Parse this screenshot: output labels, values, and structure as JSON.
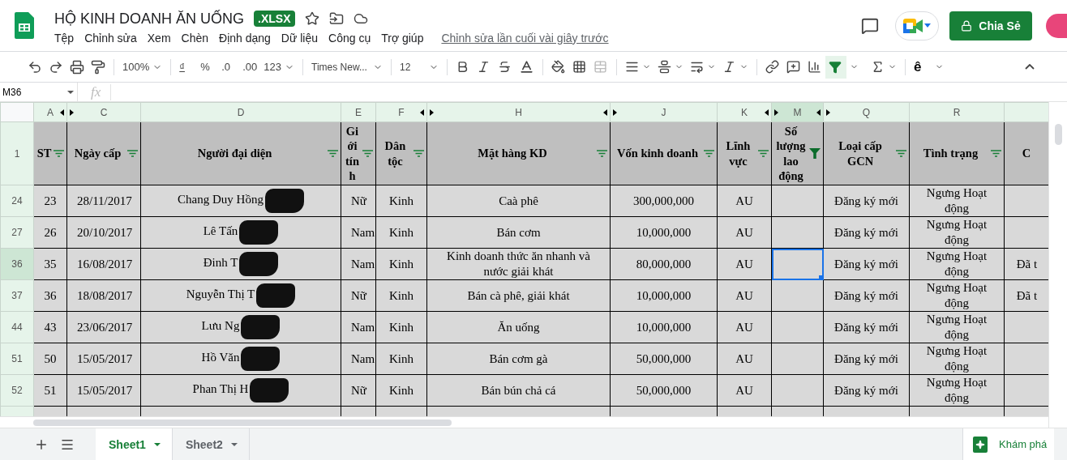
{
  "document": {
    "title": "HỘ KINH DOANH ĂN UỐNG",
    "badge": ".XLSX",
    "last_edit": "Chỉnh sửa lần cuối vài giây trước"
  },
  "menu": [
    "Tệp",
    "Chỉnh sửa",
    "Xem",
    "Chèn",
    "Định dạng",
    "Dữ liệu",
    "Công cụ",
    "Trợ giúp"
  ],
  "share_button": "Chia Sẻ",
  "toolbar": {
    "zoom": "100%",
    "currency": "₫",
    "percent": "%",
    "decrease_decimals": ".0",
    "increase_decimals": ".00",
    "number_format": "123",
    "font": "Times New...",
    "font_size": "12",
    "input_tool": "ê",
    "filter_on": true
  },
  "name_box": "M36",
  "formula_label": "fx",
  "columns": [
    {
      "letter": "A",
      "header": "ST",
      "filtered": false,
      "selected": false,
      "hidden_before": false,
      "hidden_after": true
    },
    {
      "letter": "C",
      "header": "Ngày cấp",
      "filtered": false,
      "selected": false,
      "hidden_before": true,
      "hidden_after": false
    },
    {
      "letter": "D",
      "header": "Người đại diện",
      "filtered": false,
      "selected": false,
      "hidden_before": false,
      "hidden_after": false
    },
    {
      "letter": "E",
      "header": "Giới tính",
      "filtered": false,
      "selected": false,
      "hidden_before": false,
      "hidden_after": false
    },
    {
      "letter": "F",
      "header": "Dân tộc",
      "filtered": false,
      "selected": false,
      "hidden_before": false,
      "hidden_after": true
    },
    {
      "letter": "H",
      "header": "Mặt hàng KD",
      "filtered": false,
      "selected": false,
      "hidden_before": true,
      "hidden_after": true
    },
    {
      "letter": "J",
      "header": "Vốn kinh doanh",
      "filtered": false,
      "selected": false,
      "hidden_before": true,
      "hidden_after": false
    },
    {
      "letter": "K",
      "header": "Lĩnh vực",
      "filtered": false,
      "selected": false,
      "hidden_before": false,
      "hidden_after": true
    },
    {
      "letter": "M",
      "header": "Số lượng lao động",
      "filtered": true,
      "selected": true,
      "hidden_before": true,
      "hidden_after": true
    },
    {
      "letter": "Q",
      "header": "Loại cấp GCN",
      "filtered": false,
      "selected": false,
      "hidden_before": true,
      "hidden_after": false
    },
    {
      "letter": "R",
      "header": "Tình trạng",
      "filtered": false,
      "selected": false,
      "hidden_before": false,
      "hidden_after": false
    },
    {
      "header": "C",
      "selected": false,
      "hidden_before": false,
      "hidden_after": false
    }
  ],
  "header_row": "1",
  "rows": [
    {
      "number": "24",
      "selected": false,
      "redacted": true,
      "cells": {
        "0": "23",
        "1": "28/11/2017",
        "2": "Chang Duy Hồng",
        "3": "Nữ",
        "4": "Kinh",
        "5": "Caà phê",
        "6": "300,000,000",
        "7": "AU",
        "9": "Đăng ký mới",
        "10": "Ngưng Hoạt động"
      }
    },
    {
      "number": "27",
      "selected": false,
      "redacted": true,
      "cells": {
        "0": "26",
        "1": "20/10/2017",
        "2": "Lê Tấn",
        "3": "Nam",
        "4": "Kinh",
        "5": "Bán cơm",
        "6": "10,000,000",
        "7": "AU",
        "9": "Đăng ký mới",
        "10": "Ngưng Hoạt động"
      }
    },
    {
      "number": "36",
      "selected": true,
      "redacted": true,
      "cells": {
        "0": "35",
        "1": "16/08/2017",
        "2": "Đinh T",
        "3": "Nam",
        "4": "Kinh",
        "5": "Kinh doanh thức ăn nhanh và nước giải khát",
        "6": "80,000,000",
        "7": "AU",
        "9": "Đăng ký mới",
        "10": "Ngưng Hoạt động",
        "11": "Đã t"
      }
    },
    {
      "number": "37",
      "selected": false,
      "redacted": true,
      "cells": {
        "0": "36",
        "1": "18/08/2017",
        "2": "Nguyễn Thị T",
        "3": "Nữ",
        "4": "Kinh",
        "5": "Bán cà phê, giải khát",
        "6": "10,000,000",
        "7": "AU",
        "9": "Đăng ký mới",
        "10": "Ngưng Hoạt động",
        "11": "Đã t"
      }
    },
    {
      "number": "44",
      "selected": false,
      "redacted": true,
      "cells": {
        "0": "43",
        "1": "23/06/2017",
        "2": "Lưu Ng",
        "3": "Nam",
        "4": "Kinh",
        "5": "Ăn uống",
        "6": "10,000,000",
        "7": "AU",
        "9": "Đăng ký mới",
        "10": "Ngưng Hoạt động"
      }
    },
    {
      "number": "51",
      "selected": false,
      "redacted": true,
      "cells": {
        "0": "50",
        "1": "15/05/2017",
        "2": "Hồ Văn",
        "3": "Nam",
        "4": "Kinh",
        "5": "Bán cơm gà",
        "6": "50,000,000",
        "7": "AU",
        "9": "Đăng ký mới",
        "10": "Ngưng Hoạt động"
      }
    },
    {
      "number": "52",
      "selected": false,
      "redacted": true,
      "cells": {
        "0": "51",
        "1": "15/05/2017",
        "2": "Phan Thị H",
        "3": "Nữ",
        "4": "Kinh",
        "5": "Bán bún chả cá",
        "6": "50,000,000",
        "7": "AU",
        "9": "Đăng ký mới",
        "10": "Ngưng Hoạt động"
      }
    }
  ],
  "sheets": [
    {
      "label": "Sheet1",
      "selected": true
    },
    {
      "label": "Sheet2",
      "selected": false
    }
  ],
  "explore_button": "Khám phá"
}
